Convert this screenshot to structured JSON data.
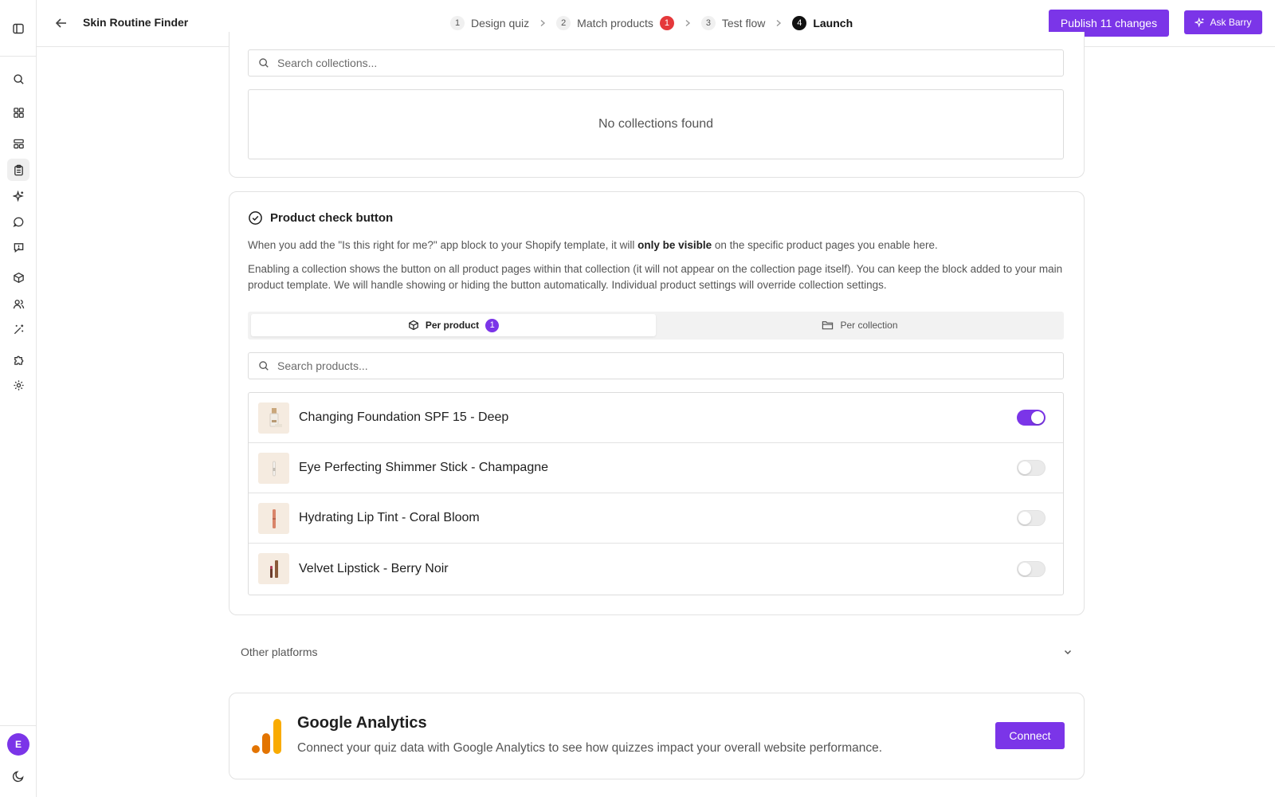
{
  "header": {
    "title": "Skin Routine Finder",
    "steps": [
      {
        "num": "1",
        "label": "Design quiz"
      },
      {
        "num": "2",
        "label": "Match products",
        "badge": "1"
      },
      {
        "num": "3",
        "label": "Test flow"
      },
      {
        "num": "4",
        "label": "Launch"
      }
    ],
    "publish_label": "Publish 11 changes",
    "ask_label": "Ask Barry"
  },
  "sidebar": {
    "avatar_initial": "E",
    "icons": [
      "search-icon",
      "grid-icon",
      "layout-icon",
      "clipboard-icon",
      "sparkle-icon",
      "chat-icon",
      "message-square-icon",
      "box-icon",
      "users-icon",
      "wand-icon",
      "puzzle-icon",
      "gear-icon"
    ]
  },
  "collections": {
    "search_placeholder": "Search collections...",
    "empty_text": "No collections found"
  },
  "product_check": {
    "title": "Product check button",
    "para1_pre": "When you add the \"Is this right for me?\" app block to your Shopify template, it will ",
    "para1_bold": "only be visible",
    "para1_post": " on the specific product pages you enable here.",
    "para2": "Enabling a collection shows the button on all product pages within that collection (it will not appear on the collection page itself). You can keep the block added to your main product template. We will handle showing or hiding the button automatically. Individual product settings will override collection settings.",
    "tabs": [
      {
        "label": "Per product",
        "count": "1",
        "active": true
      },
      {
        "label": "Per collection",
        "active": false
      }
    ],
    "search_placeholder": "Search products...",
    "products": [
      {
        "name": "Changing Foundation SPF 15 - Deep",
        "enabled": true
      },
      {
        "name": "Eye Perfecting Shimmer Stick - Champagne",
        "enabled": false
      },
      {
        "name": "Hydrating Lip Tint - Coral Bloom",
        "enabled": false
      },
      {
        "name": "Velvet Lipstick - Berry Noir",
        "enabled": false
      }
    ]
  },
  "other_platforms": {
    "label": "Other platforms"
  },
  "google_analytics": {
    "title": "Google Analytics",
    "description": "Connect your quiz data with Google Analytics to see how quizzes impact your overall website performance.",
    "connect_label": "Connect"
  },
  "colors": {
    "accent": "#7b35e8",
    "badge_red": "#e5383b",
    "ga_orange": "#f9ab00",
    "ga_dark_orange": "#e37400"
  }
}
